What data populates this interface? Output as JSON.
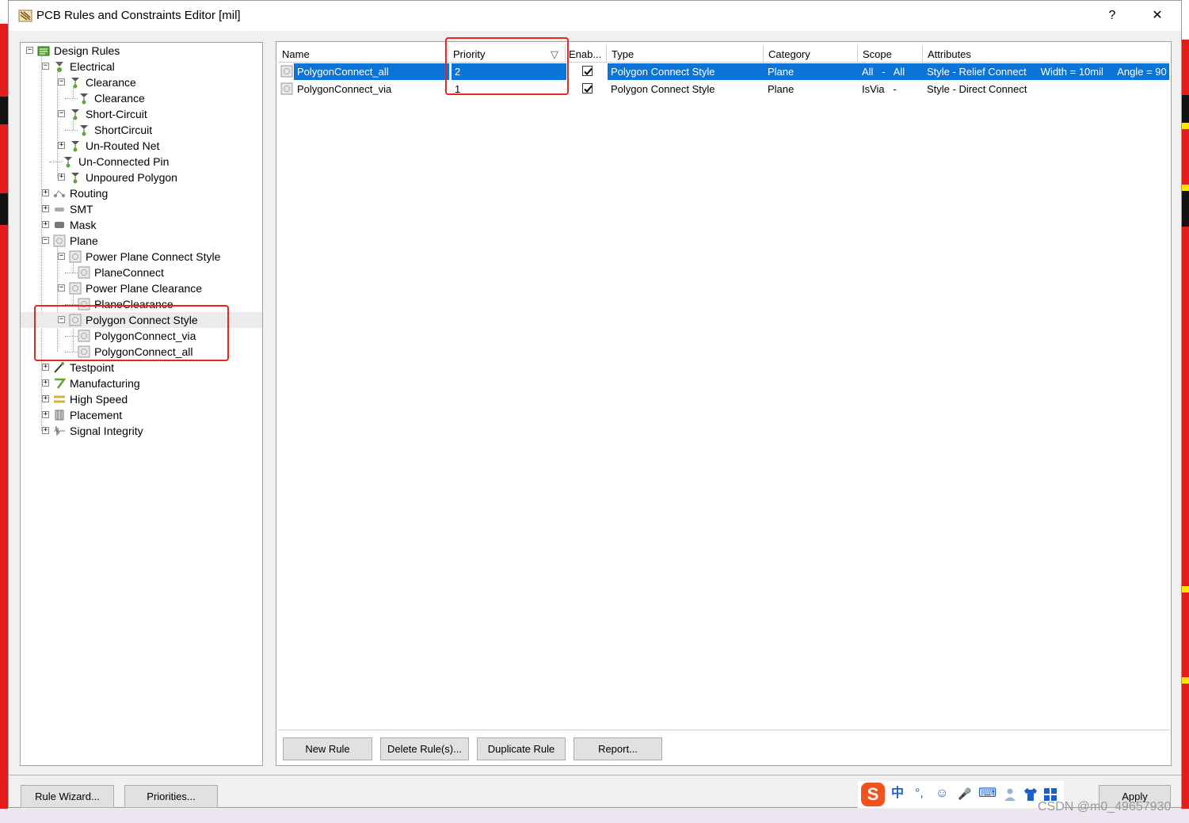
{
  "window": {
    "title": "PCB Rules and Constraints Editor [mil]",
    "help_label": "?",
    "close_label": "✕"
  },
  "tree": [
    {
      "label": "Design Rules",
      "icon": "design-rules-icon",
      "expander": "minus"
    },
    {
      "label": "Electrical",
      "icon": "electrical-icon",
      "expander": "minus"
    },
    {
      "label": "Clearance",
      "icon": "rule-icon",
      "expander": "minus"
    },
    {
      "label": "Clearance",
      "icon": "rule-icon",
      "expander": ""
    },
    {
      "label": "Short-Circuit",
      "icon": "rule-icon",
      "expander": "minus"
    },
    {
      "label": "ShortCircuit",
      "icon": "rule-icon",
      "expander": ""
    },
    {
      "label": "Un-Routed Net",
      "icon": "rule-icon",
      "expander": "plus"
    },
    {
      "label": "Un-Connected Pin",
      "icon": "rule-icon",
      "expander": ""
    },
    {
      "label": "Unpoured Polygon",
      "icon": "rule-icon",
      "expander": "plus"
    },
    {
      "label": "Routing",
      "icon": "routing-icon",
      "expander": "plus"
    },
    {
      "label": "SMT",
      "icon": "smt-icon",
      "expander": "plus"
    },
    {
      "label": "Mask",
      "icon": "mask-icon",
      "expander": "plus"
    },
    {
      "label": "Plane",
      "icon": "plane-icon",
      "expander": "minus"
    },
    {
      "label": "Power Plane Connect Style",
      "icon": "plane-icon",
      "expander": "minus"
    },
    {
      "label": "PlaneConnect",
      "icon": "plane-icon",
      "expander": ""
    },
    {
      "label": "Power Plane Clearance",
      "icon": "plane-icon",
      "expander": "minus"
    },
    {
      "label": "PlaneClearance",
      "icon": "plane-icon",
      "expander": ""
    },
    {
      "label": "Polygon Connect Style",
      "icon": "plane-icon",
      "expander": "minus"
    },
    {
      "label": "PolygonConnect_via",
      "icon": "plane-icon",
      "expander": ""
    },
    {
      "label": "PolygonConnect_all",
      "icon": "plane-icon",
      "expander": ""
    },
    {
      "label": "Testpoint",
      "icon": "testpoint-icon",
      "expander": "plus"
    },
    {
      "label": "Manufacturing",
      "icon": "manufacturing-icon",
      "expander": "plus"
    },
    {
      "label": "High Speed",
      "icon": "high-speed-icon",
      "expander": "plus"
    },
    {
      "label": "Placement",
      "icon": "placement-icon",
      "expander": "plus"
    },
    {
      "label": "Signal Integrity",
      "icon": "signal-integrity-icon",
      "expander": "plus"
    }
  ],
  "grid": {
    "columns": [
      "Name",
      "Priority",
      "Enab...",
      "Type",
      "Category",
      "Scope",
      "Attributes"
    ],
    "sort_indicator": "▽",
    "rows": [
      {
        "name": "PolygonConnect_all",
        "priority": "2",
        "enabled": true,
        "type": "Polygon Connect Style",
        "category": "Plane",
        "scope": "All   -   All",
        "attributes": "Style - Relief Connect     Width = 10mil     Angle = 90"
      },
      {
        "name": "PolygonConnect_via",
        "priority": "1",
        "enabled": true,
        "type": "Polygon Connect Style",
        "category": "Plane",
        "scope": "IsVia   -",
        "attributes": "Style - Direct Connect"
      }
    ],
    "selected_row": 0
  },
  "grid_buttons": {
    "new_rule": "New Rule",
    "delete_rules": "Delete Rule(s)...",
    "duplicate_rule": "Duplicate Rule",
    "report": "Report..."
  },
  "footer": {
    "rule_wizard": "Rule Wizard...",
    "priorities": "Priorities...",
    "apply": "Apply"
  },
  "ime": {
    "logo": "S",
    "lang": "中",
    "punct": "°,",
    "emoji": "☺",
    "mic": "🎤",
    "keyboard": "⌨"
  },
  "watermark": "CSDN @m0_49657930",
  "colors": {
    "selection": "#0a74d8",
    "highlight_box": "#e8261f"
  }
}
